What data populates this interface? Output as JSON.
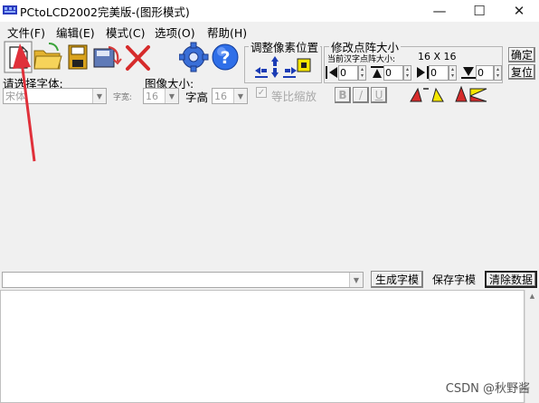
{
  "window": {
    "title": "PCtoLCD2002完美版-(图形模式)",
    "minimize_glyph": "—",
    "maximize_glyph": "☐",
    "close_glyph": "✕"
  },
  "menu": {
    "items": [
      "文件(F)",
      "编辑(E)",
      "模式(C)",
      "选项(O)",
      "帮助(H)"
    ]
  },
  "pixel_group": {
    "title": "调整像素位置"
  },
  "matrix_group": {
    "title": "修改点阵大小",
    "current_size_label": "当前汉字点阵大小:",
    "size_display": "16 X 16",
    "values": [
      "0",
      "0",
      "0",
      "0"
    ],
    "confirm_label": "确定",
    "restore_label": "复位"
  },
  "font_select": {
    "label": "请选择字体:",
    "value": "宋体",
    "charset_label": "字宽:"
  },
  "image_size": {
    "label": "图像大小:",
    "width_value": "16",
    "height_label": "字高",
    "height_value": "16",
    "proportional_label": "等比缩放",
    "proportional_checked": true
  },
  "style_buttons": {
    "bold": "B",
    "italic": "/",
    "underline": "U"
  },
  "input_row": {
    "generate_label": "生成字模",
    "save_label": "保存字模",
    "clear_label": "清除数据"
  },
  "watermark": "CSDN @秋野酱",
  "colors": {
    "arrow": "#e0303a",
    "delete_x": "#d62b2b",
    "gear": "#3a6fd8",
    "help": "#2f6fe8"
  }
}
